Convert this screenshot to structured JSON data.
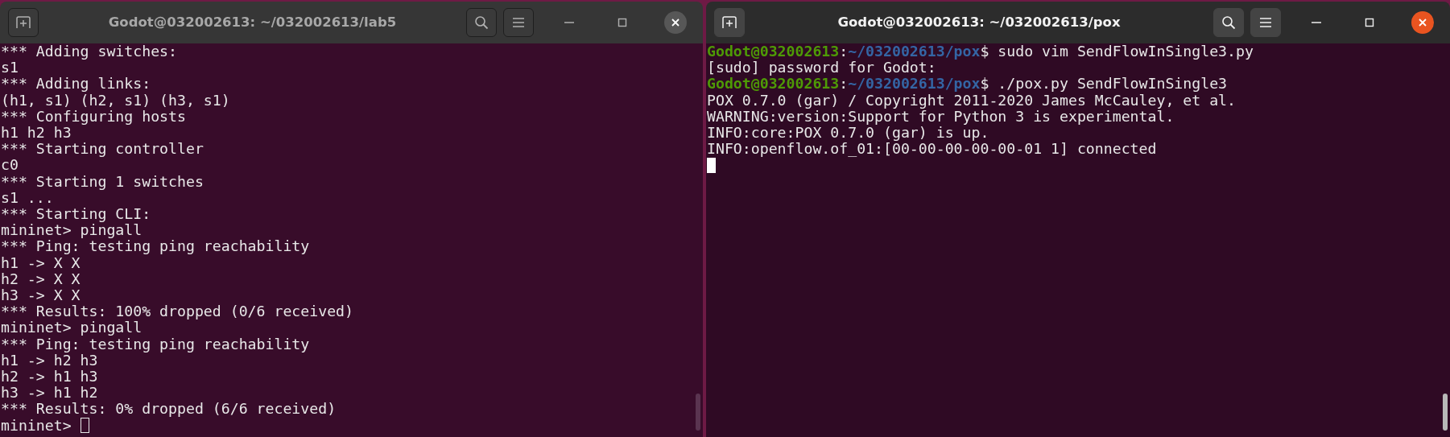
{
  "windows": [
    {
      "title": "Godot@032002613: ~/032002613/lab5",
      "focused": false,
      "lines": [
        {
          "kind": "output",
          "text": "*** Adding switches:"
        },
        {
          "kind": "output",
          "text": "s1"
        },
        {
          "kind": "output",
          "text": "*** Adding links:"
        },
        {
          "kind": "output",
          "text": "(h1, s1) (h2, s1) (h3, s1)"
        },
        {
          "kind": "output",
          "text": "*** Configuring hosts"
        },
        {
          "kind": "output",
          "text": "h1 h2 h3"
        },
        {
          "kind": "output",
          "text": "*** Starting controller"
        },
        {
          "kind": "output",
          "text": "c0"
        },
        {
          "kind": "output",
          "text": "*** Starting 1 switches"
        },
        {
          "kind": "output",
          "text": "s1 ..."
        },
        {
          "kind": "output",
          "text": "*** Starting CLI:"
        },
        {
          "kind": "output",
          "text": "mininet> pingall"
        },
        {
          "kind": "output",
          "text": "*** Ping: testing ping reachability"
        },
        {
          "kind": "output",
          "text": "h1 -> X X"
        },
        {
          "kind": "output",
          "text": "h2 -> X X"
        },
        {
          "kind": "output",
          "text": "h3 -> X X"
        },
        {
          "kind": "output",
          "text": "*** Results: 100% dropped (0/6 received)"
        },
        {
          "kind": "output",
          "text": "mininet> pingall"
        },
        {
          "kind": "output",
          "text": "*** Ping: testing ping reachability"
        },
        {
          "kind": "output",
          "text": "h1 -> h2 h3"
        },
        {
          "kind": "output",
          "text": "h2 -> h1 h3"
        },
        {
          "kind": "output",
          "text": "h3 -> h1 h2"
        },
        {
          "kind": "output",
          "text": "*** Results: 0% dropped (6/6 received)"
        },
        {
          "kind": "input",
          "text": "mininet>"
        }
      ]
    },
    {
      "title": "Godot@032002613: ~/032002613/pox",
      "focused": true,
      "lines": [
        {
          "kind": "prompt",
          "user": "Godot@032002613",
          "separator": ":",
          "path": "~/032002613/pox",
          "symbol": "$",
          "command": "sudo vim SendFlowInSingle3.py"
        },
        {
          "kind": "output",
          "text": "[sudo] password for Godot:"
        },
        {
          "kind": "prompt",
          "user": "Godot@032002613",
          "separator": ":",
          "path": "~/032002613/pox",
          "symbol": "$",
          "command": "./pox.py SendFlowInSingle3"
        },
        {
          "kind": "output",
          "text": "POX 0.7.0 (gar) / Copyright 2011-2020 James McCauley, et al."
        },
        {
          "kind": "output",
          "text": "WARNING:version:Support for Python 3 is experimental."
        },
        {
          "kind": "output",
          "text": "INFO:core:POX 0.7.0 (gar) is up."
        },
        {
          "kind": "output",
          "text": "INFO:openflow.of_01:[00-00-00-00-00-01 1] connected"
        },
        {
          "kind": "input"
        }
      ]
    }
  ]
}
